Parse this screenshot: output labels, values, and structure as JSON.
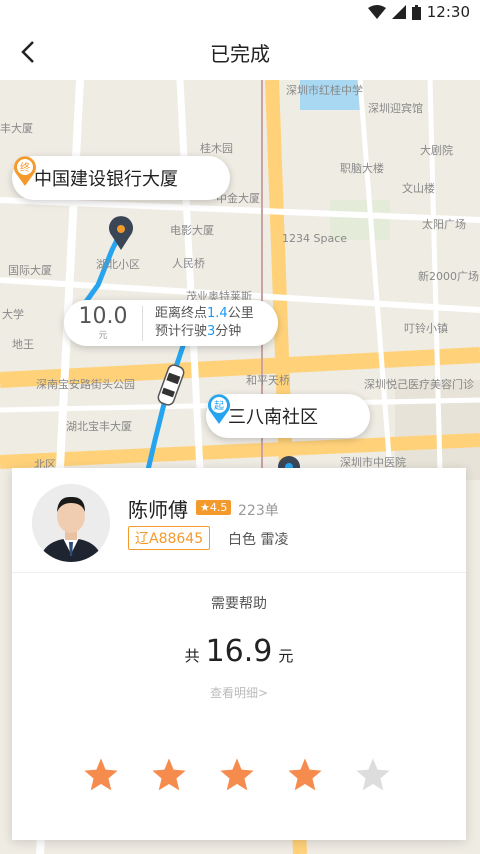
{
  "status": {
    "time": "12:30"
  },
  "header": {
    "title": "已完成"
  },
  "map": {
    "labels": [
      "深圳市红桂中学",
      "深圳迎宾馆",
      "大剧院",
      "职脑大楼",
      "电影大厦",
      "桂木园",
      "中金大厦",
      "1234 Space",
      "太阳广场",
      "新2000广场",
      "文山楼",
      "人民桥",
      "深南宝安路街头公园",
      "茂业奥特莱斯",
      "叮铃小镇",
      "深圳悦己医疗美容门诊",
      "和平天桥",
      "深圳市中医院",
      "湖北宝丰大厦",
      "北区",
      "国际大厦",
      "湖北小区",
      "丰大厦",
      "地王",
      "大学"
    ],
    "destination": {
      "tag": "终",
      "name": "中国建设银行大厦"
    },
    "origin": {
      "tag": "起",
      "name": "三八南社区"
    },
    "trip": {
      "fare": "10.0",
      "fare_unit": "元",
      "dist_prefix": "距离终点",
      "dist": "1.4",
      "dist_suffix": "公里",
      "eta_prefix": "预计行驶",
      "eta": "3",
      "eta_suffix": "分钟"
    }
  },
  "driver": {
    "name": "陈师傅",
    "rating": "★4.5",
    "orders": "223单",
    "plate": "辽A88645",
    "car": "白色  雷凌"
  },
  "summary": {
    "help": "需要帮助",
    "total_prefix": "共",
    "total": "16.9",
    "total_unit": "元",
    "details": "查看明细>"
  },
  "rating": {
    "value": 4,
    "max": 5
  },
  "colors": {
    "accent": "#f49a2d",
    "route": "#27a4f0",
    "star_on": "#f58b4c",
    "star_off": "#dddddd"
  }
}
